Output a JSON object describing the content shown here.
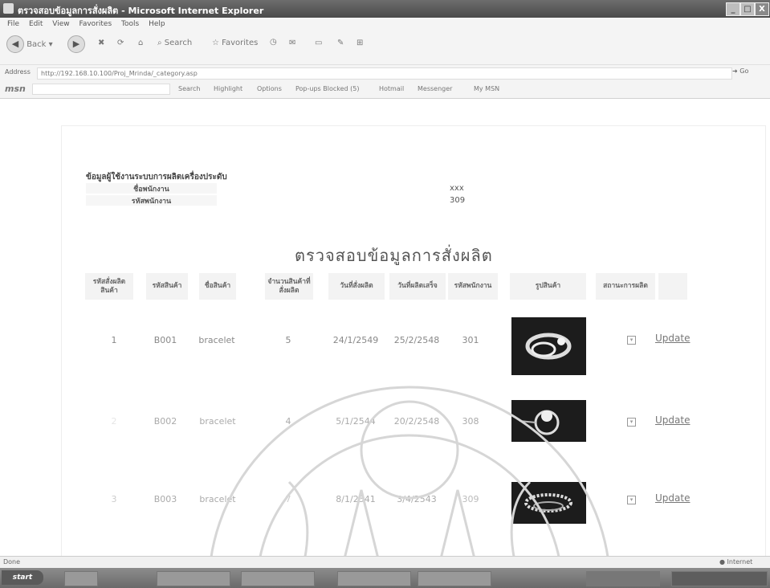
{
  "window": {
    "title": "ตรวจสอบข้อมูลการสั่งผลิต - Microsoft Internet Explorer",
    "buttons": [
      "_",
      "□",
      "X"
    ]
  },
  "menu": [
    "File",
    "Edit",
    "View",
    "Favorites",
    "Tools",
    "Help"
  ],
  "toolbar": {
    "back": "Back",
    "search": "Search",
    "favorites": "Favorites"
  },
  "address": {
    "url": "http://192.168.10.100/Proj_Mrinda/_category.asp"
  },
  "links": {
    "brand": "msn",
    "search": "Search",
    "highlight": "Highlight",
    "options": "Options",
    "popups": "Pop-ups Blocked (5)",
    "hotmail": "Hotmail",
    "messenger": "Messenger",
    "mymsn": "My MSN"
  },
  "userinfo": {
    "heading": "ข้อมูลผู้ใช้งานระบบการผลิตเครื่องประดับ",
    "name_label": "ชื่อพนักงาน",
    "name_value": "xxx",
    "id_label": "รหัสพนักงาน",
    "id_value": "309"
  },
  "page_title": "ตรวจสอบข้อมูลการสั่งผลิต",
  "table": {
    "headers": [
      "รหัสสั่งผลิตสินค้า",
      "รหัสสินค้า",
      "ชื่อสินค้า",
      "จำนวนสินค้าที่สั่งผลิต",
      "วันที่สั่งผลิต",
      "วันที่ผลิตเสร็จ",
      "รหัสพนักงาน",
      "รูปสินค้า",
      "สถานะการผลิต"
    ],
    "rows": [
      {
        "order_id": "1",
        "product_id": "B001",
        "name": "bracelet",
        "qty": "5",
        "order_date": "24/1/2549",
        "done_date": "25/2/2548",
        "emp": "301",
        "update": "Update"
      },
      {
        "order_id": "2",
        "product_id": "B002",
        "name": "bracelet",
        "qty": "4",
        "order_date": "5/1/2544",
        "done_date": "20/2/2548",
        "emp": "308",
        "update": "Update"
      },
      {
        "order_id": "3",
        "product_id": "B003",
        "name": "bracelet",
        "qty": "7",
        "order_date": "8/1/2541",
        "done_date": "3/4/2543",
        "emp": "309",
        "update": "Update"
      }
    ]
  },
  "status": {
    "left": "Done",
    "right": "Internet"
  },
  "taskbar": {
    "start": "start"
  },
  "colors": {
    "titlebar": "#5a5a5a",
    "background": "#ffffff",
    "header_cell": "#f3f3f3"
  }
}
